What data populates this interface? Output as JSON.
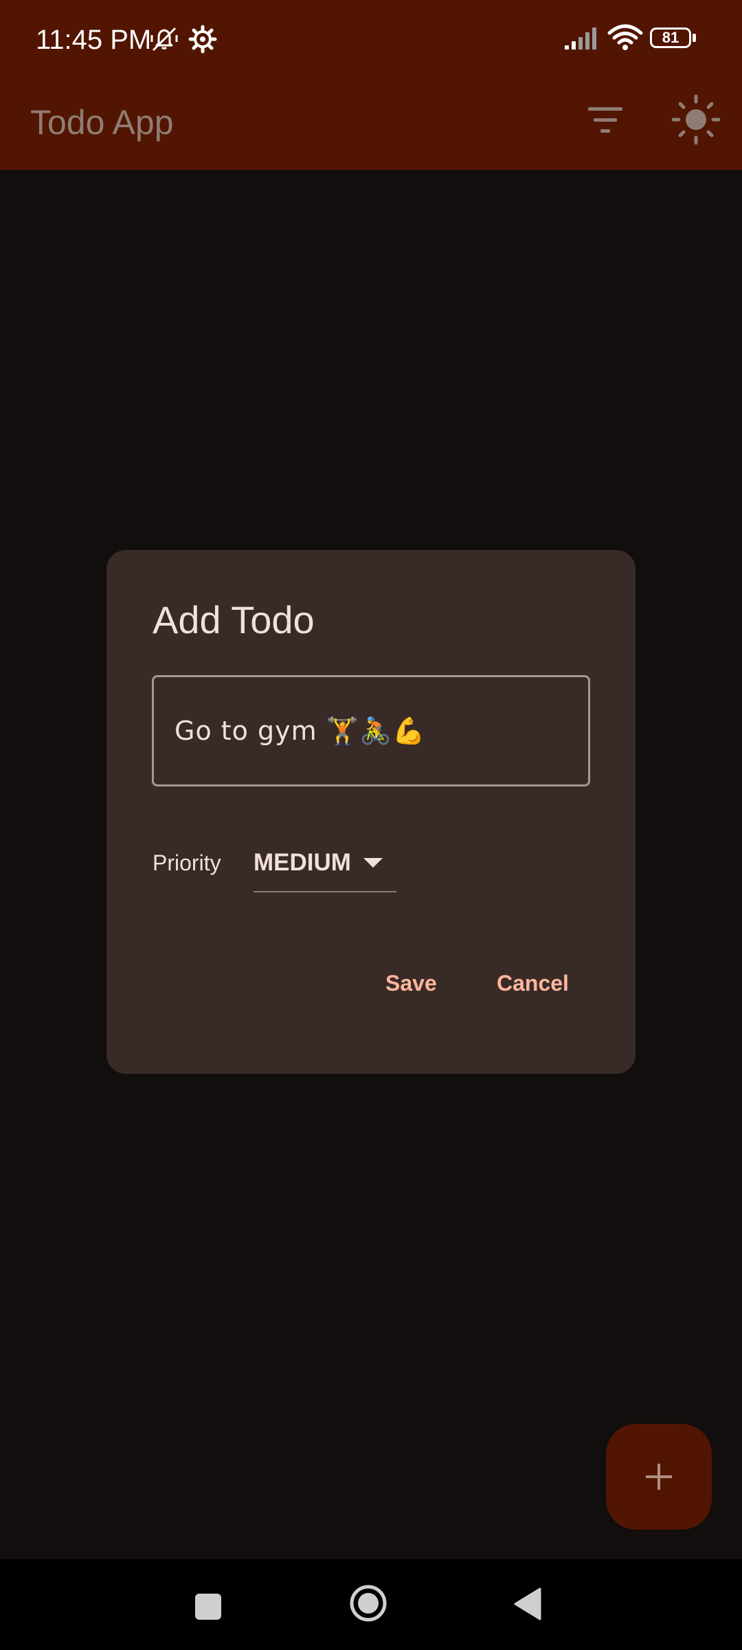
{
  "status_bar": {
    "time": "11:45 PM",
    "battery_level": "81",
    "icons": [
      "mute-icon",
      "settings-icon",
      "signal-icon",
      "wifi-icon",
      "battery-icon"
    ]
  },
  "app_bar": {
    "title": "Todo App",
    "actions": [
      "filter-icon",
      "theme-toggle-icon"
    ]
  },
  "dialog": {
    "title": "Add Todo",
    "todo_input": {
      "value": "Go to gym 🏋️🚴💪"
    },
    "priority": {
      "label": "Priority",
      "selected": "MEDIUM"
    },
    "actions": {
      "save_label": "Save",
      "cancel_label": "Cancel"
    }
  },
  "fab": {
    "icon": "plus-icon"
  },
  "nav_bar": {
    "buttons": [
      "recents-icon",
      "home-icon",
      "back-icon"
    ]
  },
  "colors": {
    "app_bar": "#521501",
    "background": "#110e0d",
    "dialog": "#382b27",
    "accent_text": "#ffb59d",
    "dialog_text": "#f2e0da"
  }
}
